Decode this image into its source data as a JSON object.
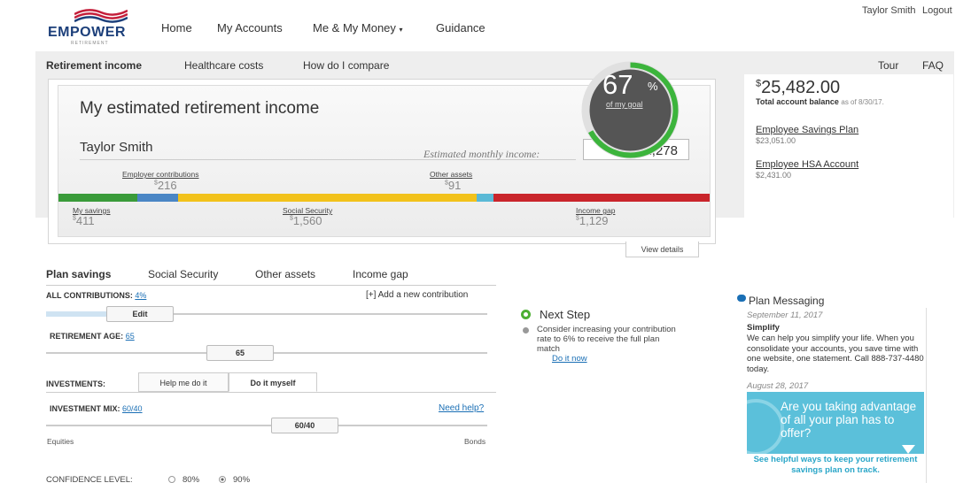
{
  "header": {
    "logo_text": "EMPOWER",
    "logo_sub": "RETIREMENT",
    "nav": [
      "Home",
      "My Accounts",
      "Me & My Money",
      "Guidance"
    ],
    "user_name": "Taylor Smith",
    "logout": "Logout"
  },
  "subtabs": [
    "Retirement income",
    "Healthcare costs",
    "How do I compare"
  ],
  "help_links": {
    "tour": "Tour",
    "faq": "FAQ"
  },
  "income_card": {
    "title": "My estimated retirement income",
    "name": "Taylor Smith",
    "est_label": "Estimated monthly income:",
    "currency": "$",
    "est_value": "2,278",
    "segments_top": [
      {
        "label": "Employer contributions",
        "value": "216"
      },
      {
        "label": "Other assets",
        "value": "91"
      }
    ],
    "segments_bottom": [
      {
        "label": "My savings",
        "value": "411"
      },
      {
        "label": "Social Security",
        "value": "1,560"
      },
      {
        "label": "Income gap",
        "value": "1,129"
      }
    ],
    "bar_colors": [
      "#3a9b3a",
      "#4a86c5",
      "#f2c21b",
      "#5ab9d6",
      "#c9252b"
    ],
    "bar_values": [
      411,
      216,
      1560,
      91,
      1129
    ],
    "view_details": "View details"
  },
  "goal": {
    "percent": "67",
    "pct_sign": "%",
    "value": 0.67,
    "label": "of my goal",
    "color": "#3cb43c"
  },
  "balance": {
    "currency": "$",
    "amount": "25,482.00",
    "label": "Total account balance",
    "as_of": "as of 8/30/17.",
    "accounts": [
      {
        "name": "Employee Savings Plan",
        "amount": "$23,051.00"
      },
      {
        "name": "Employee HSA Account",
        "amount": "$2,431.00"
      }
    ]
  },
  "plan_tabs": [
    "Plan savings",
    "Social Security",
    "Other assets",
    "Income gap"
  ],
  "contributions": {
    "label": "ALL CONTRIBUTIONS:",
    "value": "4%",
    "add": "[+] Add a new contribution",
    "edit": "Edit"
  },
  "retirement_age": {
    "label": "RETIREMENT AGE:",
    "value": "65",
    "handle": "65"
  },
  "investments": {
    "label": "INVESTMENTS:",
    "tabs": [
      "Help me do it",
      "Do it myself"
    ],
    "active_tab": 1
  },
  "investment_mix": {
    "label": "INVESTMENT MIX:",
    "value": "60/40",
    "help": "Need help?",
    "handle": "60/40",
    "left": "Equities",
    "right": "Bonds"
  },
  "confidence": {
    "label": "CONFIDENCE LEVEL:",
    "options": [
      "80%",
      "90%"
    ],
    "selected": 1
  },
  "next_step": {
    "title": "Next Step",
    "text": "Consider increasing your contribution rate to 6% to receive the full plan match",
    "link": "Do it now"
  },
  "plan_messaging": {
    "title": "Plan Messaging",
    "date1": "September 11, 2017",
    "head1": "Simplify",
    "body1": "We can help you simplify your life. When you consolidate your accounts, you save time with one website, one statement. Call 888-737-4480 today.",
    "date2": "August 28, 2017",
    "promo": "Are you taking advantage of all your plan has to offer?",
    "cta": "See helpful ways to keep your retirement savings plan on track."
  }
}
